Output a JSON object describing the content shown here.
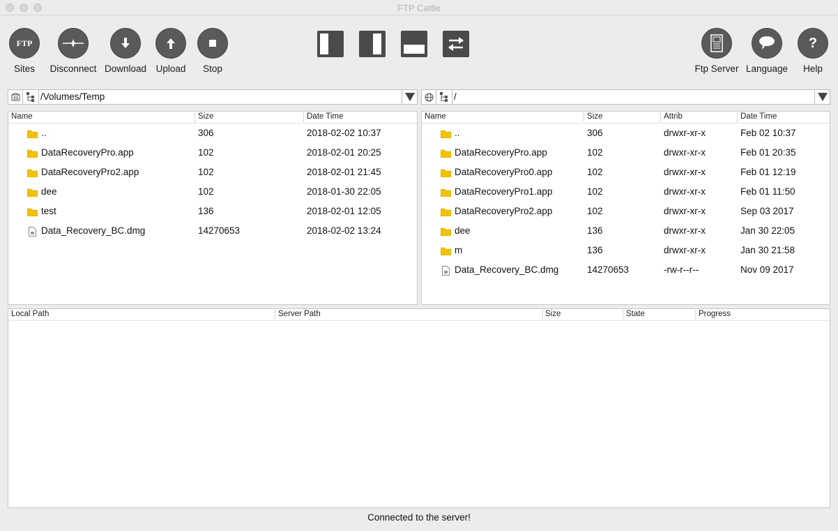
{
  "window": {
    "title": "FTP Cattle"
  },
  "colors": {
    "folder": "#f2c200",
    "button": "#5a5a5a"
  },
  "toolbar": {
    "left": [
      {
        "id": "sites",
        "label": "Sites",
        "icon": "ftp-icon"
      },
      {
        "id": "disconnect",
        "label": "Disconnect",
        "icon": "disconnect-icon"
      },
      {
        "id": "download",
        "label": "Download",
        "icon": "download-arrow-icon"
      },
      {
        "id": "upload",
        "label": "Upload",
        "icon": "upload-arrow-icon"
      },
      {
        "id": "stop",
        "label": "Stop",
        "icon": "stop-square-icon"
      }
    ],
    "ftp_glyph": "FTP",
    "layouts": [
      {
        "id": "layout-left-pane",
        "icon": "layout-left-pane-icon"
      },
      {
        "id": "layout-right-pane",
        "icon": "layout-right-pane-icon"
      },
      {
        "id": "layout-bottom-pane",
        "icon": "layout-bottom-pane-icon"
      },
      {
        "id": "swap-panes",
        "icon": "swap-arrows-icon"
      }
    ],
    "right": [
      {
        "id": "ftp-server",
        "label": "Ftp Server",
        "icon": "server-icon"
      },
      {
        "id": "language",
        "label": "Language",
        "icon": "speech-bubble-icon"
      },
      {
        "id": "help",
        "label": "Help",
        "icon": "question-icon"
      }
    ]
  },
  "local": {
    "path": "/Volumes/Temp",
    "columns": {
      "name": "Name",
      "size": "Size",
      "date": "Date Time"
    },
    "rows": [
      {
        "type": "folder",
        "name": "..",
        "size": "306",
        "date": "2018-02-02 10:37"
      },
      {
        "type": "folder",
        "name": "DataRecoveryPro.app",
        "size": "102",
        "date": "2018-02-01 20:25"
      },
      {
        "type": "folder",
        "name": "DataRecoveryPro2.app",
        "size": "102",
        "date": "2018-02-01 21:45"
      },
      {
        "type": "folder",
        "name": "dee",
        "size": "102",
        "date": "2018-01-30 22:05"
      },
      {
        "type": "folder",
        "name": "test",
        "size": "136",
        "date": "2018-02-01 12:05"
      },
      {
        "type": "file",
        "name": "Data_Recovery_BC.dmg",
        "size": "14270653",
        "date": "2018-02-02 13:24"
      }
    ]
  },
  "remote": {
    "path": "/",
    "columns": {
      "name": "Name",
      "size": "Size",
      "attrib": "Attrib",
      "date": "Date Time"
    },
    "rows": [
      {
        "type": "folder",
        "name": "..",
        "size": "306",
        "attrib": "drwxr-xr-x",
        "date": "Feb 02 10:37"
      },
      {
        "type": "folder",
        "name": "DataRecoveryPro.app",
        "size": "102",
        "attrib": "drwxr-xr-x",
        "date": "Feb 01 20:35"
      },
      {
        "type": "folder",
        "name": "DataRecoveryPro0.app",
        "size": "102",
        "attrib": "drwxr-xr-x",
        "date": "Feb 01 12:19"
      },
      {
        "type": "folder",
        "name": "DataRecoveryPro1.app",
        "size": "102",
        "attrib": "drwxr-xr-x",
        "date": "Feb 01 11:50"
      },
      {
        "type": "folder",
        "name": "DataRecoveryPro2.app",
        "size": "102",
        "attrib": "drwxr-xr-x",
        "date": "Sep 03 2017"
      },
      {
        "type": "folder",
        "name": "dee",
        "size": "136",
        "attrib": "drwxr-xr-x",
        "date": "Jan 30 22:05"
      },
      {
        "type": "folder",
        "name": "m",
        "size": "136",
        "attrib": "drwxr-xr-x",
        "date": "Jan 30 21:58"
      },
      {
        "type": "file",
        "name": "Data_Recovery_BC.dmg",
        "size": "14270653",
        "attrib": "-rw-r--r--",
        "date": "Nov 09 2017"
      }
    ]
  },
  "queue": {
    "columns": {
      "local": "Local Path",
      "server": "Server Path",
      "size": "Size",
      "state": "State",
      "progress": "Progress"
    },
    "rows": []
  },
  "status": {
    "text": "Connected to the server!"
  }
}
